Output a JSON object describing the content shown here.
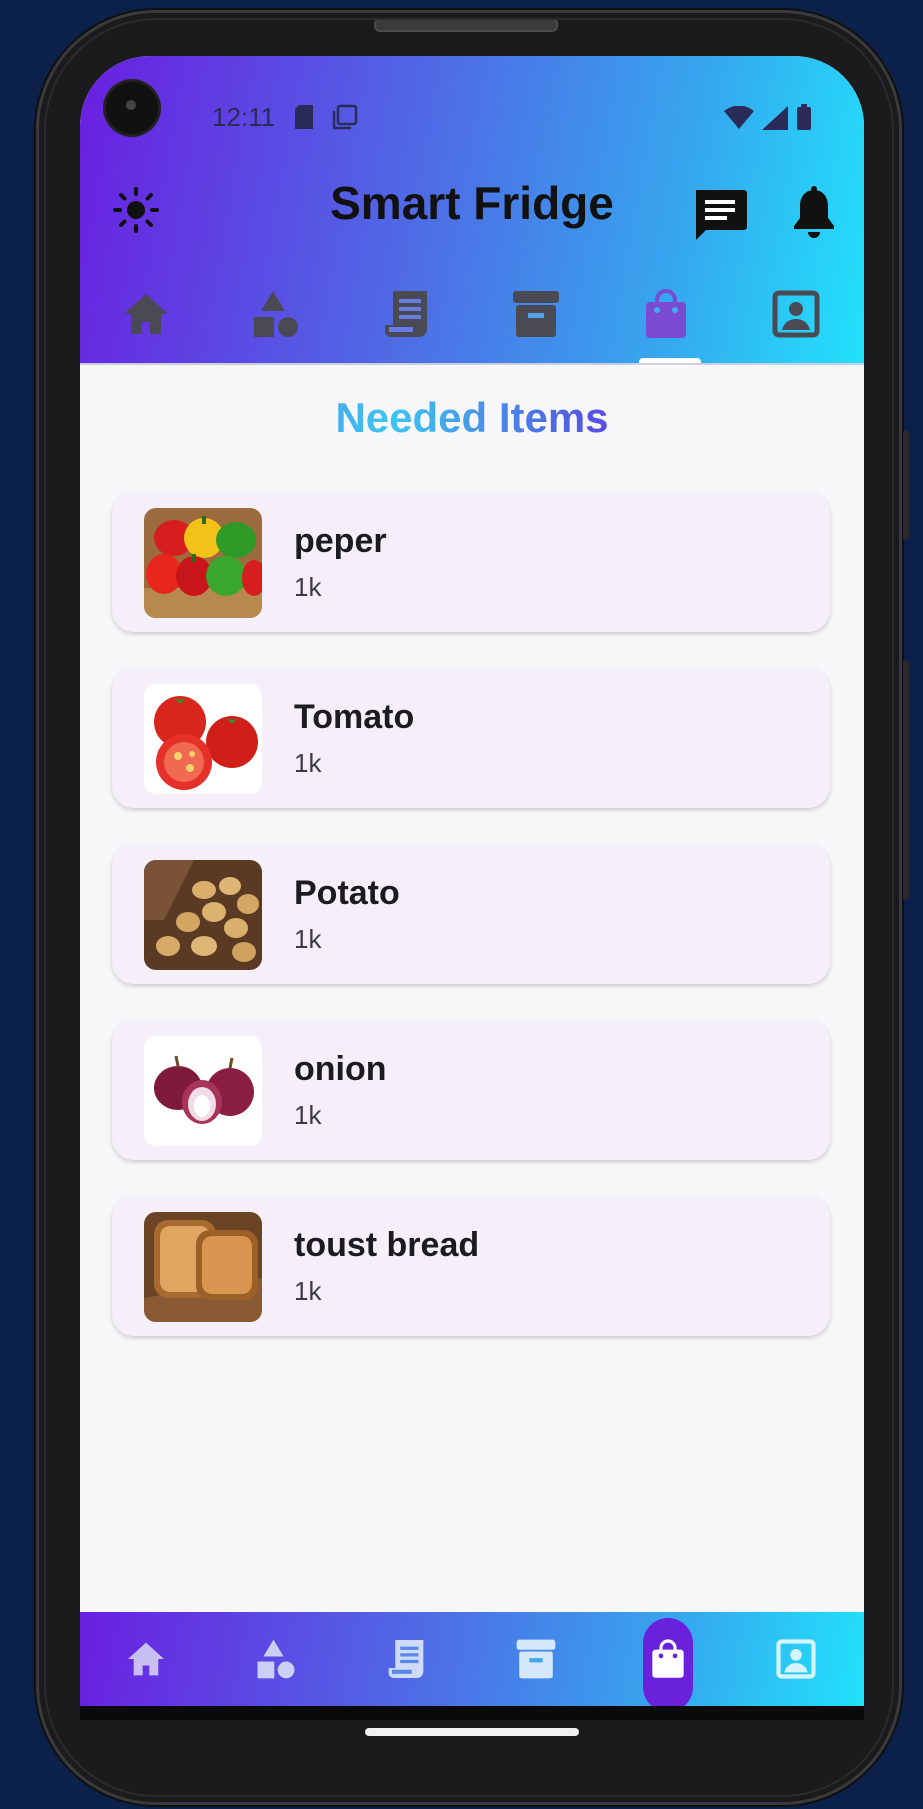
{
  "status_bar": {
    "time": "12:11"
  },
  "app": {
    "title": "Smart Fridge"
  },
  "header_actions": {
    "theme_icon": "sun-icon",
    "chat_icon": "chat-icon",
    "bell_icon": "bell-icon"
  },
  "tabs": [
    {
      "icon": "home-icon"
    },
    {
      "icon": "categories-icon"
    },
    {
      "icon": "receipt-icon"
    },
    {
      "icon": "archive-icon"
    },
    {
      "icon": "shopping-bag-icon",
      "active": true
    },
    {
      "icon": "profile-icon"
    }
  ],
  "main": {
    "section_title": "Needed Items",
    "items": [
      {
        "name": "peper",
        "qty": "1k",
        "image": "peppers-photo"
      },
      {
        "name": "Tomato",
        "qty": "1k",
        "image": "tomato-photo"
      },
      {
        "name": "Potato",
        "qty": "1k",
        "image": "potato-photo"
      },
      {
        "name": "onion",
        "qty": "1k",
        "image": "onion-photo"
      },
      {
        "name": "toust bread",
        "qty": "1k",
        "image": "toast-photo"
      }
    ]
  },
  "colors": {
    "gradient_start": "#6a1fe0",
    "gradient_end": "#22e2fb",
    "active_tab": "#6a21dc",
    "card_bg": "#f4eff8",
    "icon_dark": "#4a4a55"
  }
}
